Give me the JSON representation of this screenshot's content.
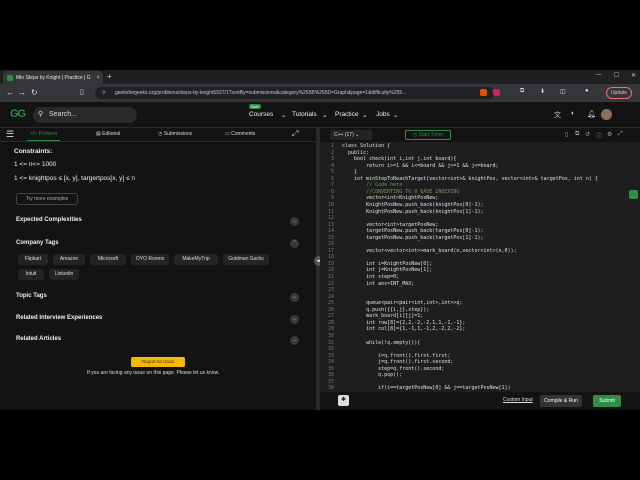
{
  "browser": {
    "tab_title": "Min Steps by Knight | Practice | G",
    "new_tab": "+",
    "url": "geeksforgeeks.org/problems/steps-by-knight5927/1?sortBy=submissions&category%255B%255D=Graph&page=1&difficulty%255...",
    "update_label": "Update"
  },
  "header": {
    "logo": "GG",
    "search_placeholder": "Search...",
    "sale_badge": "Sale",
    "nav": [
      "Courses",
      "Tutorials",
      "Practice",
      "Jobs"
    ]
  },
  "problem_tabs": [
    "Problem",
    "Editorial",
    "Submissions",
    "Comments"
  ],
  "constraints": {
    "heading": "Constraints:",
    "line1": "1 <= n<= 1000",
    "line2": "1 <= knightpos ≤ [x, y], targertpos[x, y] ≤  n",
    "more_examples": "Try more examples"
  },
  "sections": {
    "expected_complexities": "Expected Complexities",
    "company_tags": "Company Tags",
    "topic_tags": "Topic Tags",
    "related_interview": "Related Interview Experiences",
    "related_articles": "Related Articles"
  },
  "companies": [
    "Flipkart",
    "Amazon",
    "Microsoft",
    "OYO Rooms",
    "MakeMyTrip",
    "Goldman Sachs",
    "Intuit",
    "Linkedin"
  ],
  "report": {
    "button": "Report An Issue",
    "text": "If you are facing any issue on this page. Please let us know."
  },
  "editor": {
    "language": "C++ (17)",
    "timer": "Start Timer",
    "lines": [
      "class Solution {",
      "  public:",
      "    bool check(int i,int j,int board){",
      "        return i>=1 && i<=board && j>=1 && j<=board;",
      "    }",
      "    int minStepToReachTarget(vector<int>& knightPos, vector<int>& targetPos, int n) {",
      "        // Code here",
      "        //CONVERTING TO 0 BASE INDEXING",
      "        vector<int>KnightPosNew;",
      "        KnightPosNew.push_back(knightPos[0]-1);",
      "        KnightPosNew.push_back(knightPos[1]-1);",
      "",
      "        vector<int>targetPosNew;",
      "        targetPosNew.push_back(targetPos[0]-1);",
      "        targetPosNew.push_back(targetPos[1]-1);",
      "",
      "        vector<vector<int>>mark_board(n,vector<int>(n,0));",
      "",
      "        int i=KnightPosNew[0];",
      "        int j=KnightPosNew[1];",
      "        int step=0;",
      "        int ans=INT_MAX;",
      "",
      "",
      "        queue<pair<pair<int,int>,int>>q;",
      "        q.push({{i,j},step});",
      "        mark_board[i][j]=1;",
      "        int row[8]={2,2,-2,-2,1,1,-1,-1};",
      "        int col[8]={1,-1,1,-1,2,-2,2,-2};",
      "",
      "        while(!q.empty()){",
      "",
      "            i=q.front().first.first;",
      "            j=q.front().first.second;",
      "            step=q.front().second;",
      "            q.pop();",
      "",
      "            if(i==targetPosNew[0] && j==targetPosNew[1])"
    ],
    "custom_input": "Custom Input",
    "compile_run": "Compile & Run",
    "submit": "Submit"
  }
}
